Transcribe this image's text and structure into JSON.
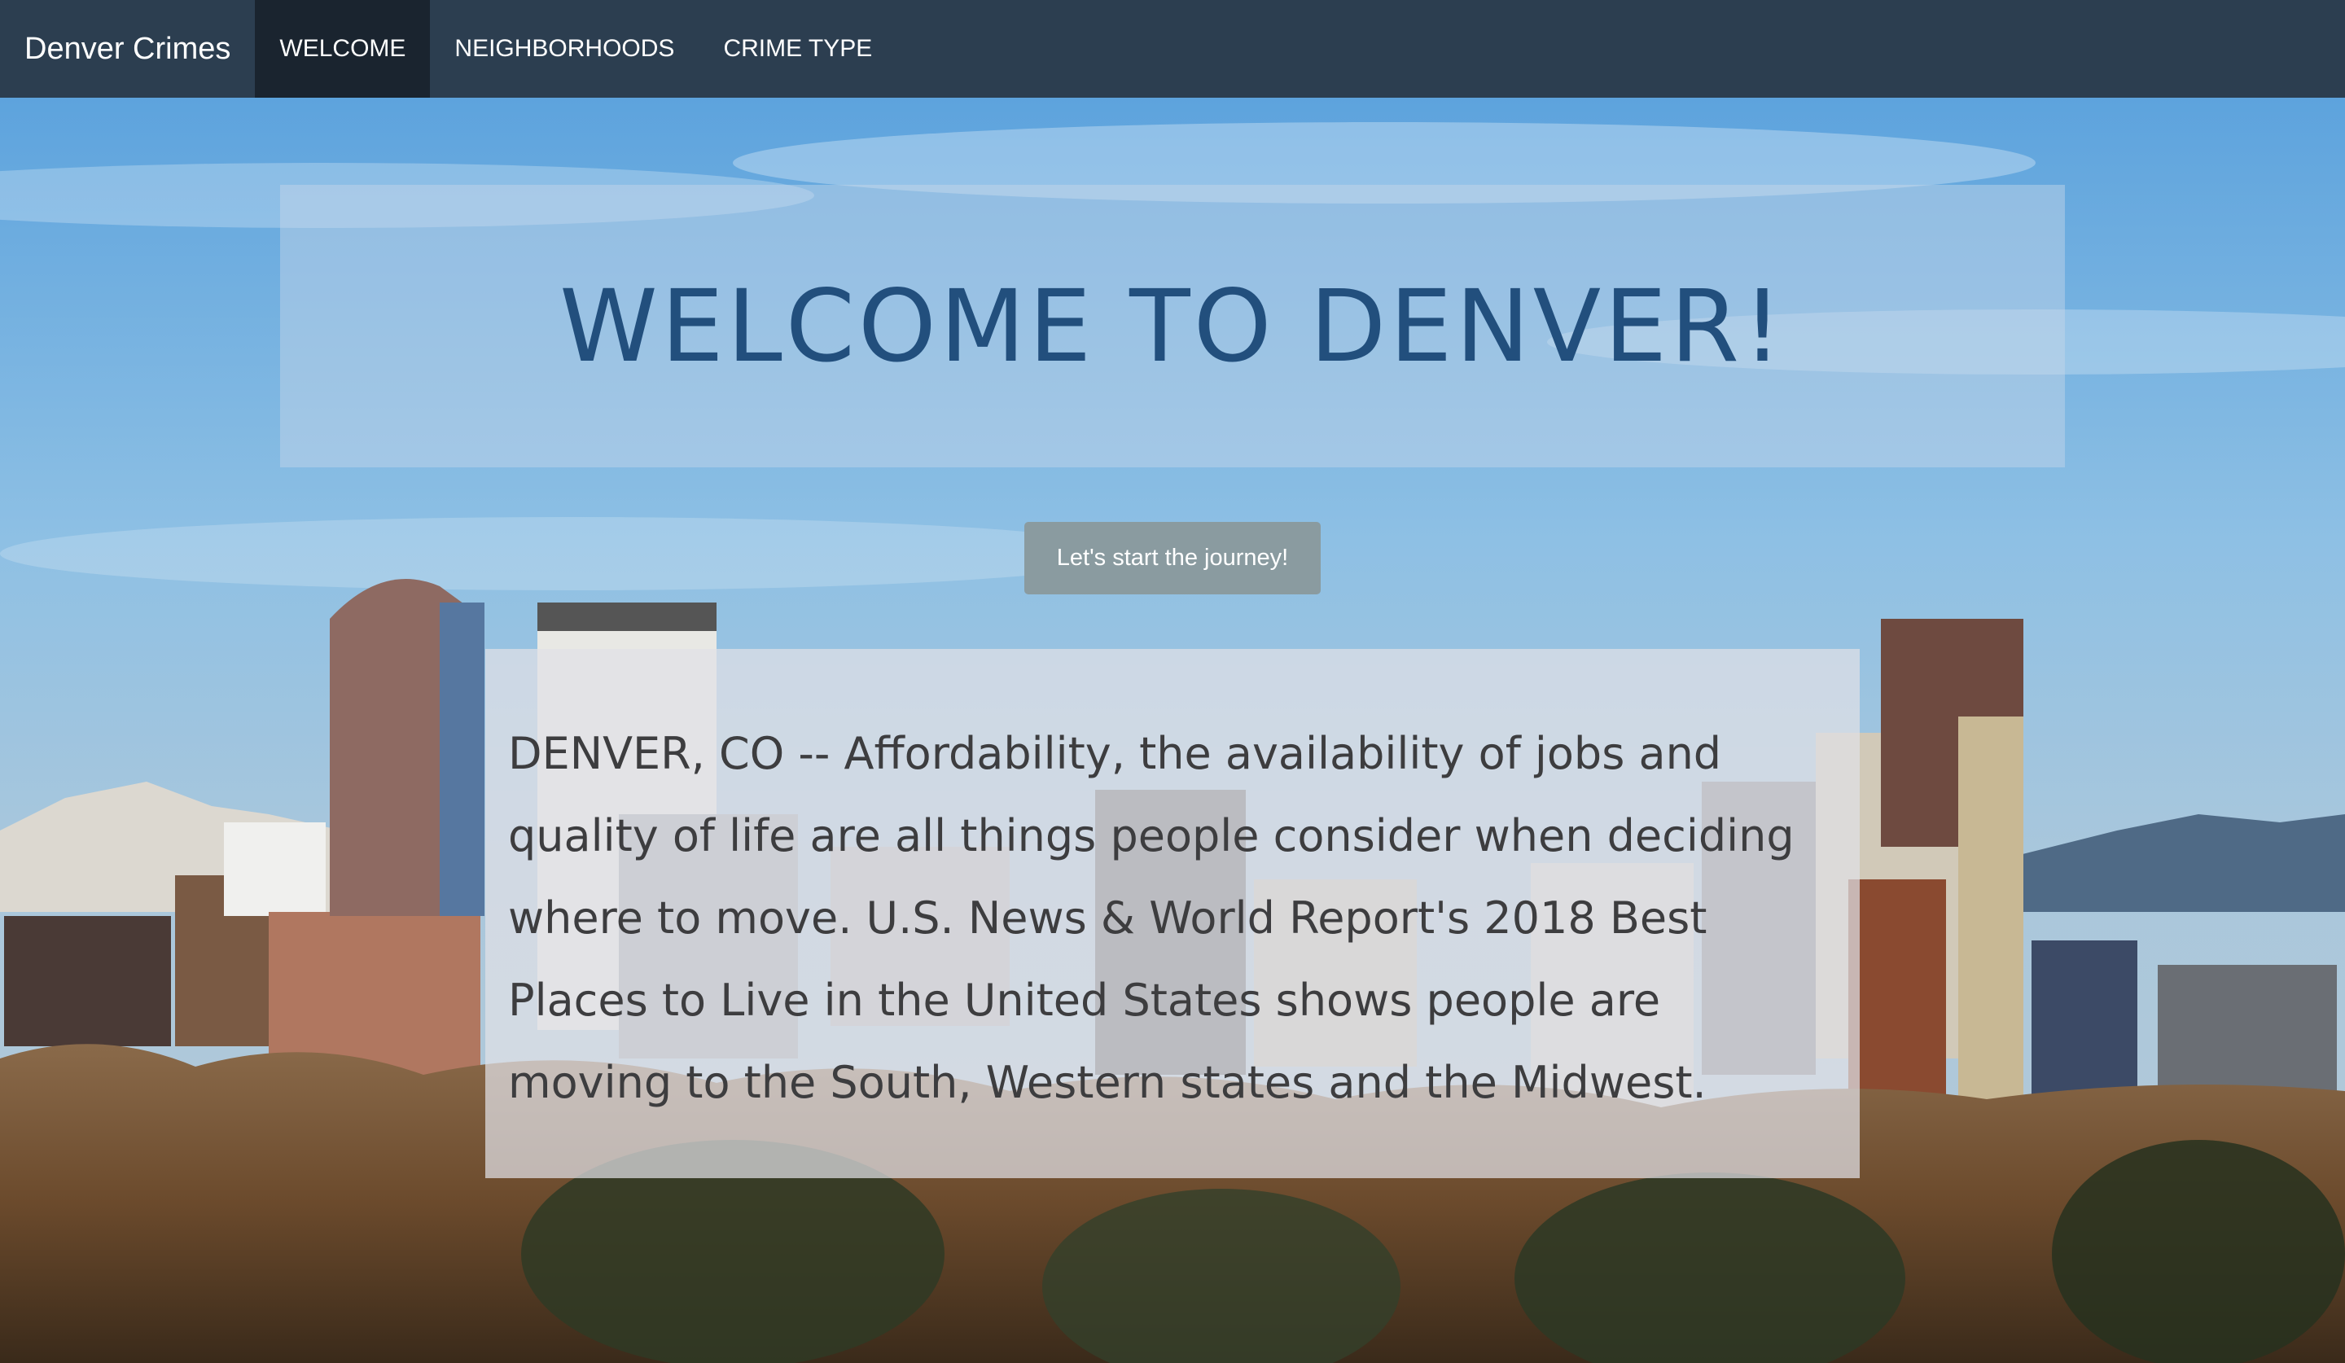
{
  "navbar": {
    "brand": "Denver Crimes",
    "items": [
      {
        "label": "WELCOME",
        "active": true
      },
      {
        "label": "NEIGHBORHOODS",
        "active": false
      },
      {
        "label": "CRIME TYPE",
        "active": false
      }
    ]
  },
  "hero": {
    "title": "WELCOME TO DENVER!",
    "cta_label": "Let's start the journey!"
  },
  "article": {
    "text": "DENVER, CO -- Affordability, the availability of jobs and quality of life are all things people consider when deciding where to move. U.S. News & World Report's 2018 Best Places to Live in the United States shows people are moving to the South, Western states and the Midwest."
  },
  "colors": {
    "navbar_bg": "#2c3e50",
    "navbar_active_bg": "#1a242f",
    "title_color": "#224f7d",
    "cta_bg": "#8a9ba0",
    "article_text": "#3d3d3f"
  }
}
